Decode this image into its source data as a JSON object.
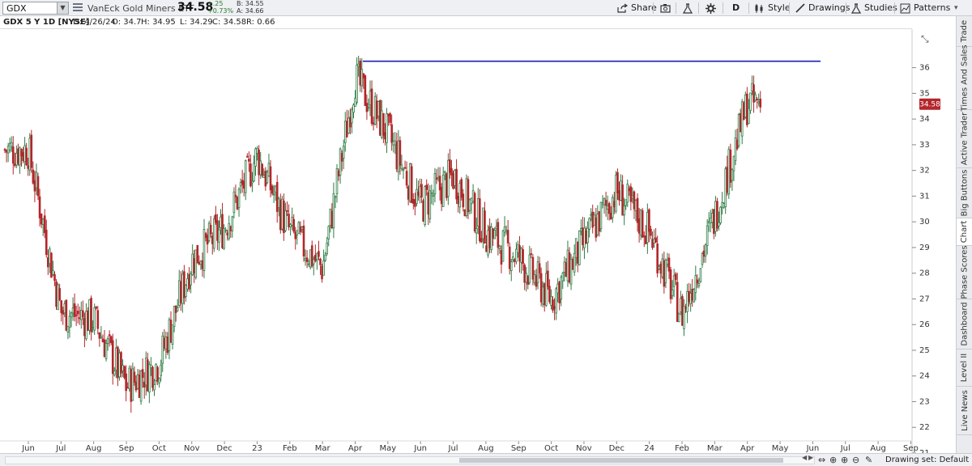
{
  "toolbar": {
    "symbol": "GDX",
    "description": "VanEck Gold Miners ETF",
    "last": "34.58",
    "change_abs": "+.25",
    "change_pct": "+0.73%",
    "bid": "B: 34.55",
    "ask": "A: 34.66",
    "share_label": "Share",
    "period_label": "D",
    "style_label": "Style",
    "drawings_label": "Drawings",
    "studies_label": "Studies",
    "patterns_label": "Patterns"
  },
  "infoline": {
    "title": "GDX 5 Y 1D [NYSE]",
    "date": "D: 4/26/24",
    "open": "O: 34.7",
    "high": "H: 34.95",
    "low": "L: 34.29",
    "close": "C: 34.58",
    "range": "R: 0.66"
  },
  "sidebar": {
    "tabs": [
      "Trade",
      "Times And Sales",
      "Active Trader",
      "Big Buttons",
      "Chart",
      "Phase Scores",
      "Dashboard",
      "Level II",
      "Live News"
    ],
    "active": "Chart"
  },
  "bottombar": {
    "drawing_set": "Drawing set: Default"
  },
  "colors": {
    "up": "#2e7d46",
    "down": "#b3262b",
    "hline": "#1b1fb5",
    "price_tag": "#b3262b"
  },
  "chart_data": {
    "type": "candlestick",
    "title": "GDX 5 Y 1D [NYSE]",
    "ylim": [
      21,
      37.5
    ],
    "y_ticks": [
      21,
      22,
      23,
      24,
      25,
      26,
      27,
      28,
      29,
      30,
      31,
      32,
      33,
      34,
      35,
      36
    ],
    "x_ticks": [
      "Jun",
      "Jul",
      "Aug",
      "Sep",
      "Oct",
      "Nov",
      "Dec",
      "23",
      "Feb",
      "Mar",
      "Apr",
      "May",
      "Jun",
      "Jul",
      "Aug",
      "Sep",
      "Oct",
      "Nov",
      "Dec",
      "24",
      "Feb",
      "Mar",
      "Apr",
      "May",
      "Jun",
      "Jul",
      "Aug",
      "Sep"
    ],
    "last_price_label": "34.58",
    "horizontal_line": 36.25,
    "approx_monthly_closes": [
      {
        "month": "Jun",
        "value": 32.8
      },
      {
        "month": "Jul",
        "value": 26.5
      },
      {
        "month": "Aug",
        "value": 26.2
      },
      {
        "month": "Sep",
        "value": 23.6
      },
      {
        "month": "Oct",
        "value": 24.5
      },
      {
        "month": "Nov",
        "value": 28.5
      },
      {
        "month": "Dec",
        "value": 29.8
      },
      {
        "month": "23",
        "value": 32.6
      },
      {
        "month": "Feb",
        "value": 29.6
      },
      {
        "month": "Mar",
        "value": 28.2
      },
      {
        "month": "Apr",
        "value": 35.6
      },
      {
        "month": "May",
        "value": 33.4
      },
      {
        "month": "Jun",
        "value": 30.6
      },
      {
        "month": "Jul",
        "value": 31.8
      },
      {
        "month": "Aug",
        "value": 29.6
      },
      {
        "month": "Sep",
        "value": 28.6
      },
      {
        "month": "Oct",
        "value": 27.0
      },
      {
        "month": "Nov",
        "value": 29.2
      },
      {
        "month": "Dec",
        "value": 31.2
      },
      {
        "month": "24",
        "value": 29.6
      },
      {
        "month": "Feb",
        "value": 26.4
      },
      {
        "month": "Mar",
        "value": 30.2
      },
      {
        "month": "Apr",
        "value": 34.6
      }
    ]
  }
}
